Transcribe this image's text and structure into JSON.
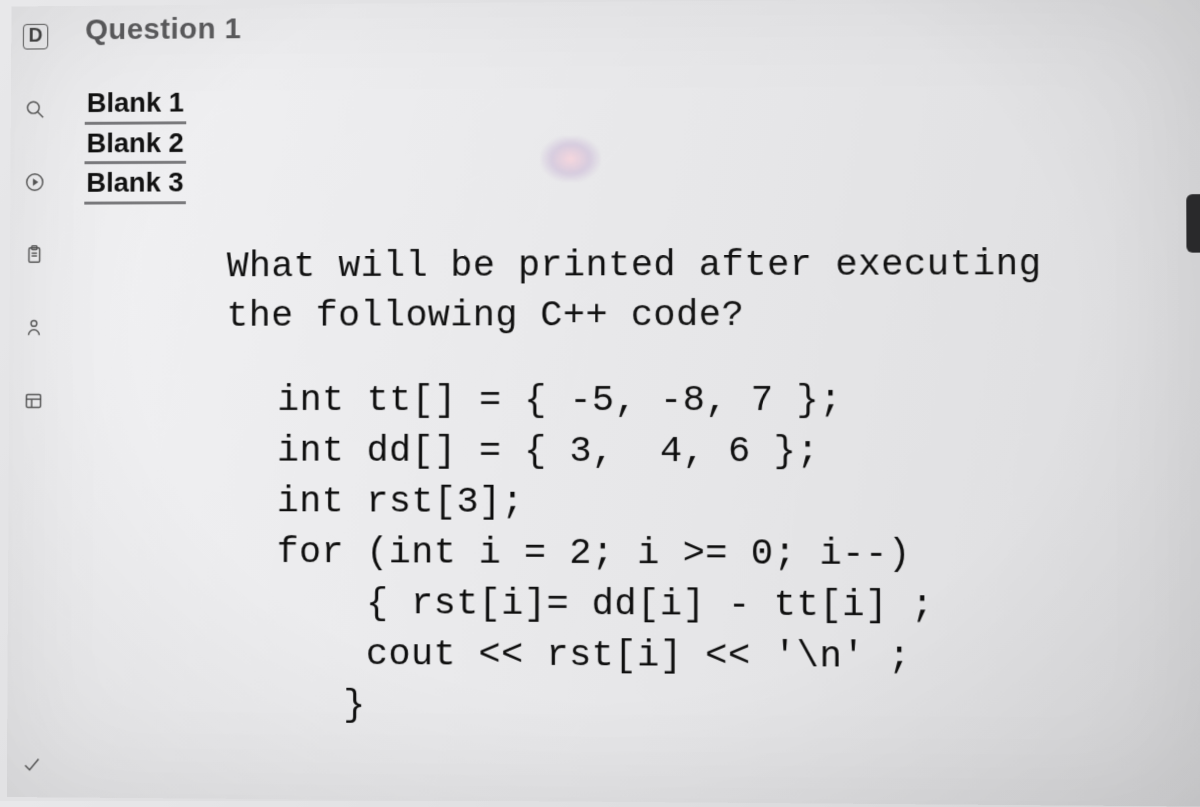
{
  "sidebar": {
    "letter": "D"
  },
  "question": {
    "title": "Question 1",
    "blanks": [
      "Blank 1",
      "Blank 2",
      "Blank 3"
    ],
    "prompt_line1": "What will be printed after executing",
    "prompt_line2": "the following C++ code?",
    "code": "int tt[] = { -5, -8, 7 };\nint dd[] = { 3,  4, 6 };\nint rst[3];\nfor (int i = 2; i >= 0; i--)\n    { rst[i]= dd[i] - tt[i] ;\n    cout << rst[i] << '\\n' ;\n   }"
  }
}
